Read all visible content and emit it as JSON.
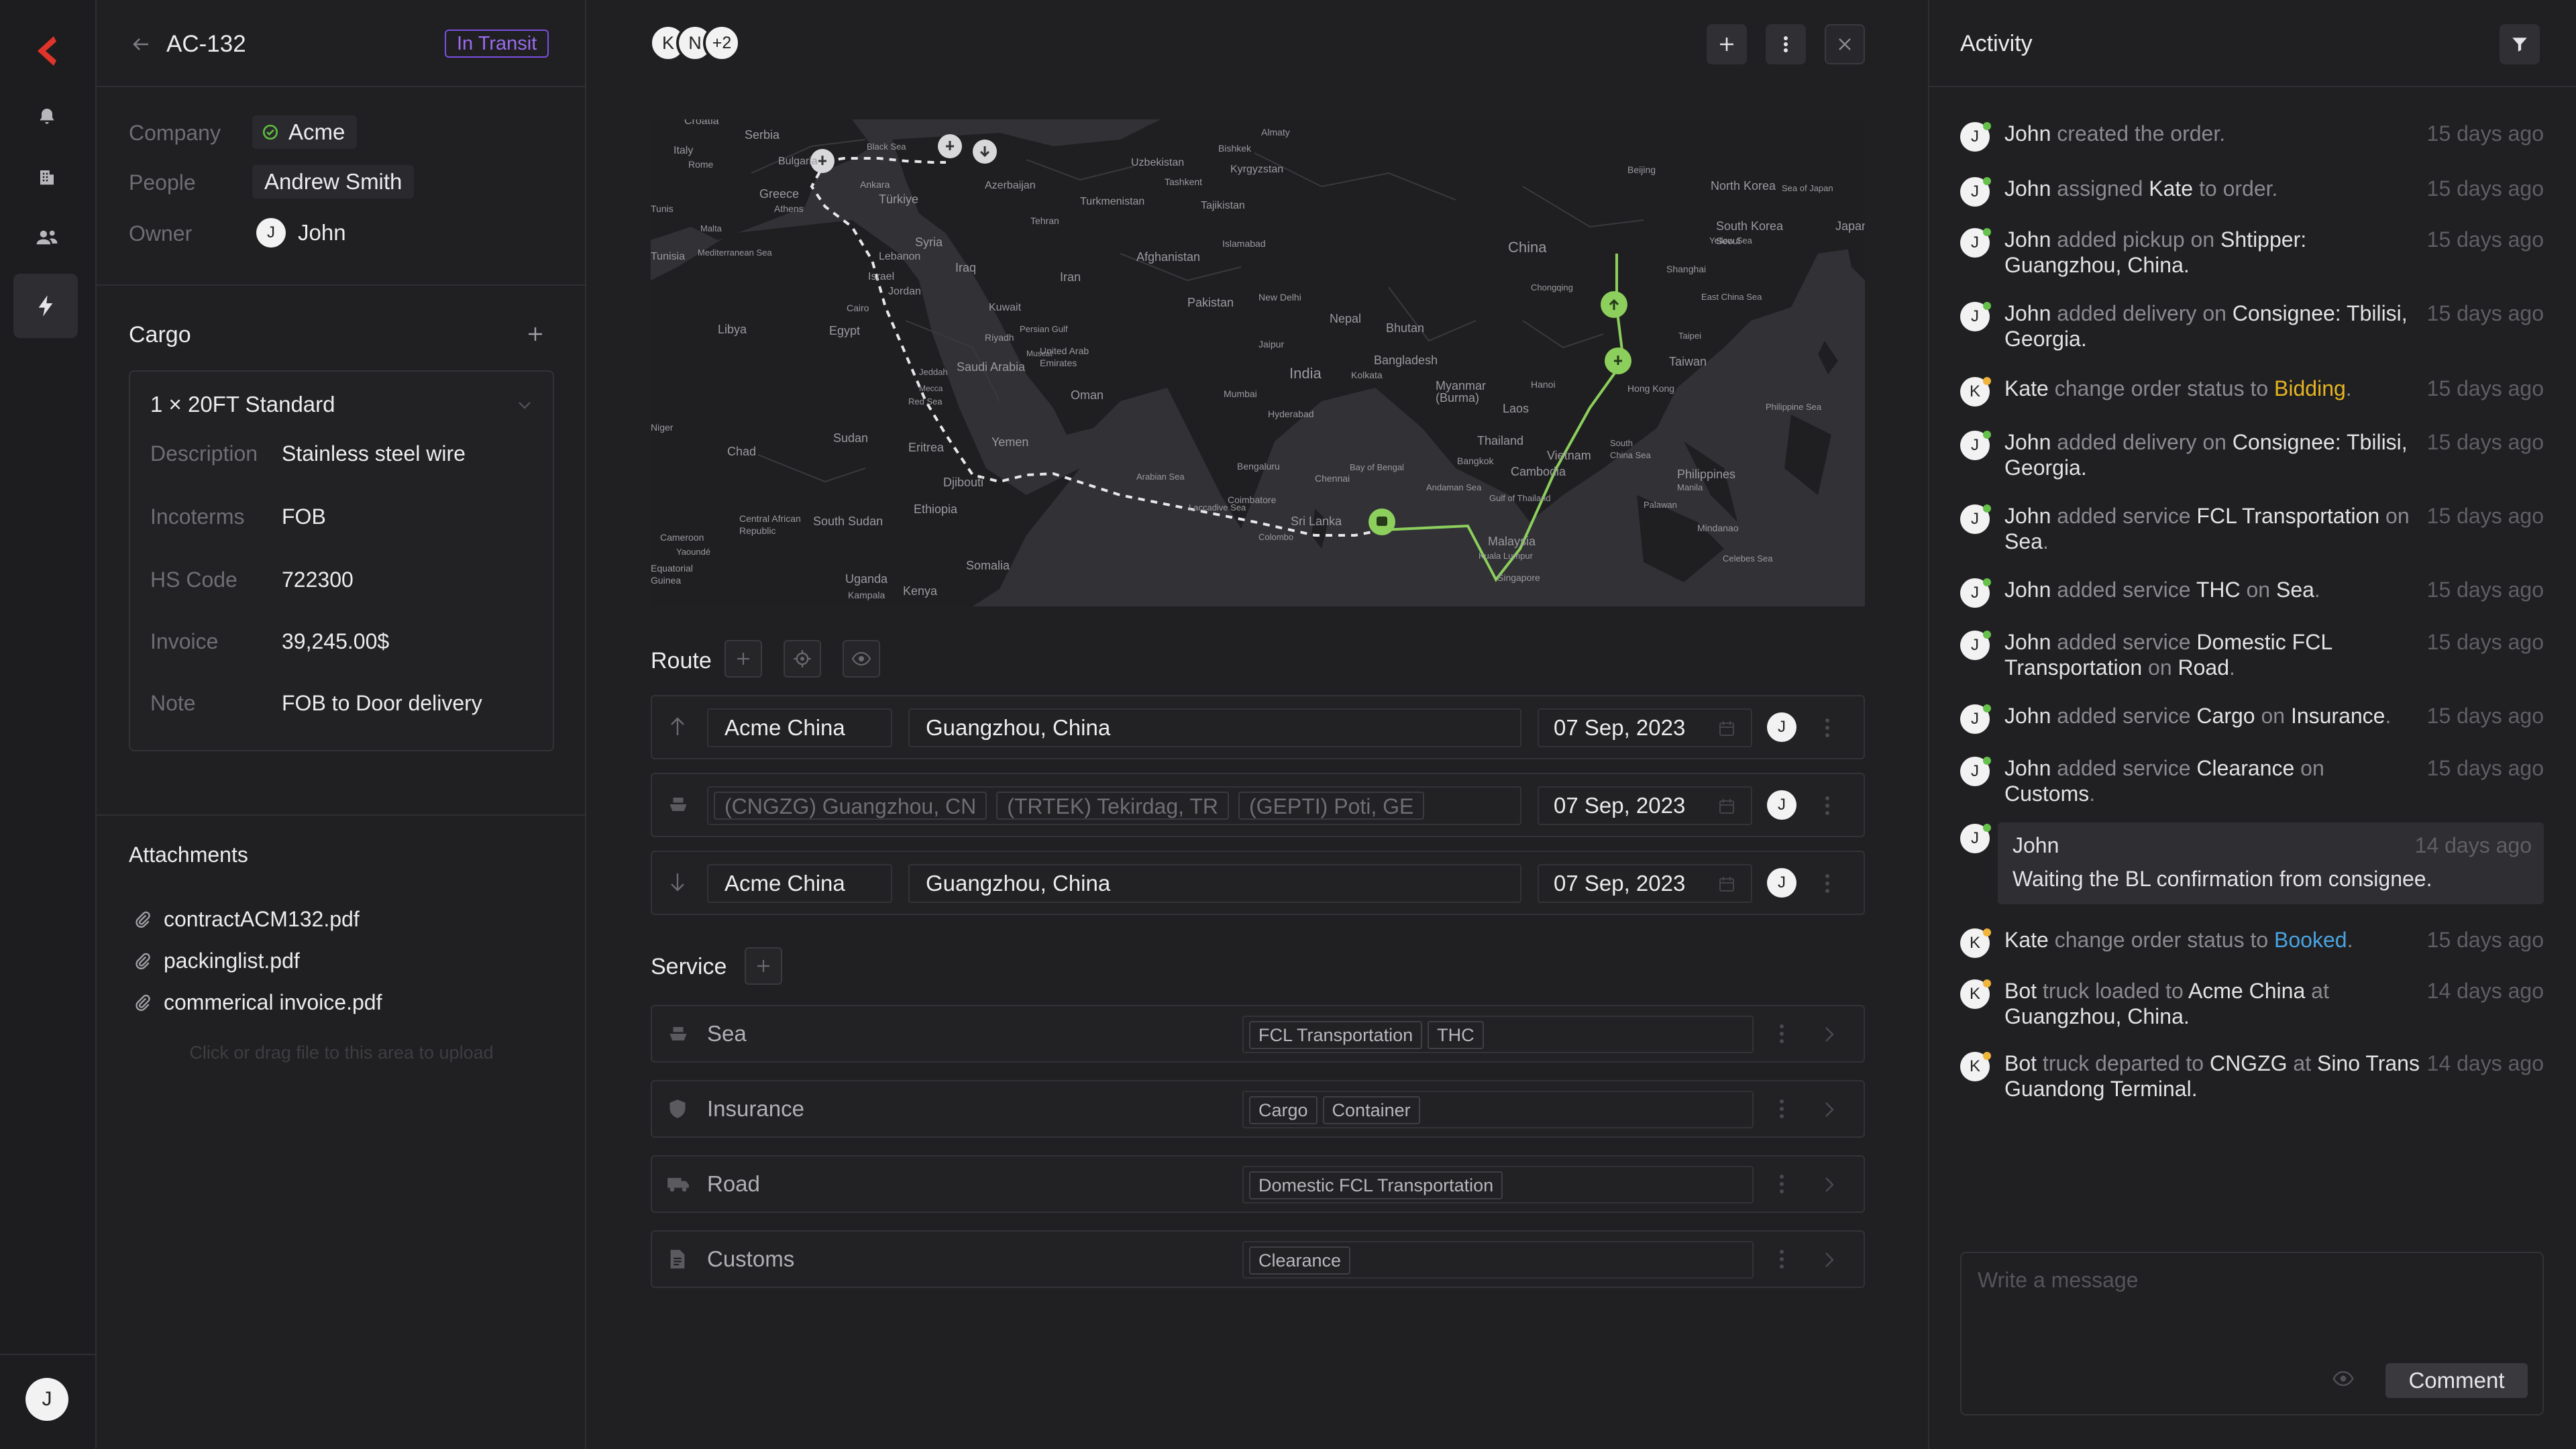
{
  "order": {
    "id": "AC-132",
    "status": "In Transit",
    "back_icon": "arrow-left-icon"
  },
  "colors": {
    "accent_red": "#e0342b",
    "status_purple": "#8c5ae6",
    "green": "#7ac55a",
    "bidding": "#e6b422",
    "booked": "#4aa3e0"
  },
  "sidebar": {
    "logo": "brand-logo-icon",
    "items": [
      "bell-icon",
      "building-icon",
      "users-icon",
      "bolt-icon"
    ],
    "user_initial": "J"
  },
  "details": {
    "company_label": "Company",
    "company": "Acme",
    "people_label": "People",
    "people": "Andrew Smith",
    "owner_label": "Owner",
    "owner": "John",
    "owner_initial": "J"
  },
  "cargo": {
    "title": "Cargo",
    "item": "1 × 20FT Standard",
    "fields": [
      {
        "label": "Description",
        "value": "Stainless steel wire"
      },
      {
        "label": "Incoterms",
        "value": "FOB"
      },
      {
        "label": "HS Code",
        "value": "722300"
      },
      {
        "label": "Invoice",
        "value": "39,245.00$"
      },
      {
        "label": "Note",
        "value": "FOB to Door delivery"
      }
    ]
  },
  "attachments": {
    "title": "Attachments",
    "files": [
      "contractACM132.pdf",
      "packinglist.pdf",
      "commerical invoice.pdf"
    ],
    "upload_hint": "Click or drag file to this area to upload"
  },
  "header": {
    "avatars": [
      "K",
      "N",
      "+2"
    ]
  },
  "map": {
    "labels": [
      "Croatia",
      "Serbia",
      "Italy",
      "Rome",
      "Bulgaria",
      "Greece",
      "Athens",
      "Türkiye",
      "Ankara",
      "Black Sea",
      "Azerbaijan",
      "Uzbekistan",
      "Bishkek",
      "Kyrgyzstan",
      "Almaty",
      "Tashkent",
      "Turkmenistan",
      "Tajikistan",
      "Syria",
      "Lebanon",
      "Iraq",
      "Iran",
      "Israel",
      "Jordan",
      "Cairo",
      "Egypt",
      "Libya",
      "Tunis",
      "Tunisia",
      "Malta",
      "Mediterranean Sea",
      "Kuwait",
      "Riyadh",
      "Saudi Arabia",
      "Persian Gulf",
      "Tehran",
      "Afghanistan",
      "Islamabad",
      "Pakistan",
      "New Delhi",
      "Nepal",
      "Bhutan",
      "India",
      "Jaipur",
      "Bangladesh",
      "Kolkata",
      "Myanmar (Burma)",
      "Mumbai",
      "Hyderabad",
      "Bengaluru",
      "Chennai",
      "Coimbatore",
      "Sri Lanka",
      "Colombo",
      "Laccadive Sea",
      "Arabian Sea",
      "Bay of Bengal",
      "Andaman Sea",
      "Thailand",
      "Bangkok",
      "Laos",
      "Hanoi",
      "Vietnam",
      "Cambodia",
      "Gulf of Thailand",
      "Malaysia",
      "Kuala Lumpur",
      "Singapore",
      "South China Sea",
      "Philippines",
      "Manila",
      "Hong Kong",
      "Taiwan",
      "Taipei",
      "Shanghai",
      "China",
      "Chongqing",
      "Beijing",
      "North Korea",
      "South Korea",
      "Seoul",
      "Sea of Japan",
      "Japan",
      "Yellow Sea",
      "East China Sea",
      "Philippine Sea",
      "Palawan",
      "Mindanao",
      "Celebes Sea",
      "Oman",
      "United Arab Emirates",
      "Yemen",
      "Eritrea",
      "Djibouti",
      "Sudan",
      "Chad",
      "Ethiopia",
      "Jeddah",
      "Red Sea",
      "Somalia",
      "Kenya",
      "Uganda",
      "Kampala",
      "South Sudan",
      "Central African Republic",
      "Cameroon",
      "Yaoundé",
      "Equatorial Guinea",
      "Niger",
      "Mecca",
      "Muscat"
    ]
  },
  "route": {
    "title": "Route",
    "toolbar_icons": [
      "plus-icon",
      "target-icon",
      "eye-icon"
    ],
    "rows": [
      {
        "icon": "arrow-up-icon",
        "company": "Acme China",
        "location": "Guangzhou, China",
        "date": "07 Sep, 2023",
        "owner": "J"
      },
      {
        "icon": "ship-icon",
        "ports": [
          "(CNGZG) Guangzhou, CN",
          "(TRTEK) Tekirdag, TR",
          "(GEPTI) Poti, GE"
        ],
        "date": "07 Sep, 2023",
        "owner": "J"
      },
      {
        "icon": "arrow-down-icon",
        "company": "Acme China",
        "location": "Guangzhou, China",
        "date": "07 Sep, 2023",
        "owner": "J"
      }
    ]
  },
  "service": {
    "title": "Service",
    "rows": [
      {
        "icon": "ship-icon",
        "name": "Sea",
        "tags": [
          "FCL Transportation",
          "THC"
        ]
      },
      {
        "icon": "shield-icon",
        "name": "Insurance",
        "tags": [
          "Cargo",
          "Container"
        ]
      },
      {
        "icon": "truck-icon",
        "name": "Road",
        "tags": [
          "Domestic FCL Transportation"
        ]
      },
      {
        "icon": "document-icon",
        "name": "Customs",
        "tags": [
          "Clearance"
        ]
      }
    ]
  },
  "activity": {
    "title": "Activity",
    "items": [
      {
        "initial": "J",
        "parts": [
          [
            "John",
            true
          ],
          [
            " created the order.",
            false
          ]
        ],
        "time": "15 days ago"
      },
      {
        "initial": "J",
        "parts": [
          [
            "John",
            true
          ],
          [
            " assigned ",
            false
          ],
          [
            "Kate",
            true
          ],
          [
            " to order.",
            false
          ]
        ],
        "time": "15 days ago"
      },
      {
        "initial": "J",
        "parts": [
          [
            "John",
            true
          ],
          [
            " added pickup on ",
            false
          ],
          [
            "Shtipper: Guangzhou, China.",
            true
          ]
        ],
        "time": "15 days ago"
      },
      {
        "initial": "J",
        "parts": [
          [
            "John",
            true
          ],
          [
            " added delivery on ",
            false
          ],
          [
            "Consignee: Tbilisi, Georgia.",
            true
          ]
        ],
        "time": "15 days ago"
      },
      {
        "initial": "K",
        "parts": [
          [
            "Kate",
            true
          ],
          [
            " change order status to ",
            false
          ],
          [
            "Bidding",
            "bidding"
          ],
          [
            ".",
            false
          ]
        ],
        "time": "15 days ago"
      },
      {
        "initial": "J",
        "parts": [
          [
            "John",
            true
          ],
          [
            " added delivery on ",
            false
          ],
          [
            "Consignee: Tbilisi, Georgia.",
            true
          ]
        ],
        "time": "15 days ago"
      },
      {
        "initial": "J",
        "parts": [
          [
            "John",
            true
          ],
          [
            " added service ",
            false
          ],
          [
            "FCL Transportation",
            true
          ],
          [
            " on ",
            false
          ],
          [
            "Sea",
            true
          ],
          [
            ".",
            false
          ]
        ],
        "time": "15 days ago"
      },
      {
        "initial": "J",
        "parts": [
          [
            "John",
            true
          ],
          [
            " added service ",
            false
          ],
          [
            "THC",
            true
          ],
          [
            " on ",
            false
          ],
          [
            "Sea",
            true
          ],
          [
            ".",
            false
          ]
        ],
        "time": "15 days ago"
      },
      {
        "initial": "J",
        "parts": [
          [
            "John",
            true
          ],
          [
            " added service ",
            false
          ],
          [
            "Domestic FCL Transportation",
            true
          ],
          [
            " on ",
            false
          ],
          [
            "Road",
            true
          ],
          [
            ".",
            false
          ]
        ],
        "time": "15 days ago"
      },
      {
        "initial": "J",
        "parts": [
          [
            "John",
            true
          ],
          [
            " added service ",
            false
          ],
          [
            "Cargo",
            true
          ],
          [
            " on ",
            false
          ],
          [
            "Insurance",
            true
          ],
          [
            ".",
            false
          ]
        ],
        "time": "15 days ago"
      },
      {
        "initial": "J",
        "parts": [
          [
            "John",
            true
          ],
          [
            " added service ",
            false
          ],
          [
            "Clearance",
            true
          ],
          [
            " on ",
            false
          ],
          [
            "Customs",
            true
          ],
          [
            ".",
            false
          ]
        ],
        "time": "15 days ago"
      }
    ],
    "comment": {
      "author": "John",
      "initial": "J",
      "time": "14 days ago",
      "text": "Waiting the BL confirmation from consignee."
    },
    "later": [
      {
        "initial": "K",
        "parts": [
          [
            "Kate",
            true
          ],
          [
            " change order status to ",
            false
          ],
          [
            "Booked",
            "booked"
          ],
          [
            ".",
            false
          ]
        ],
        "time": "15 days ago"
      },
      {
        "initial": "K",
        "parts": [
          [
            "Bot",
            true
          ],
          [
            " truck loaded to ",
            false
          ],
          [
            "Acme China",
            true
          ],
          [
            " at ",
            false
          ],
          [
            "Guangzhou, China.",
            true
          ]
        ],
        "time": "14 days ago"
      },
      {
        "initial": "K",
        "parts": [
          [
            "Bot",
            true
          ],
          [
            " truck departed to ",
            false
          ],
          [
            "CNGZG",
            true
          ],
          [
            " at ",
            false
          ],
          [
            "Sino Trans Guandong Terminal.",
            true
          ]
        ],
        "time": "14 days ago"
      }
    ],
    "placeholder": "Write a message",
    "comment_button": "Comment"
  }
}
